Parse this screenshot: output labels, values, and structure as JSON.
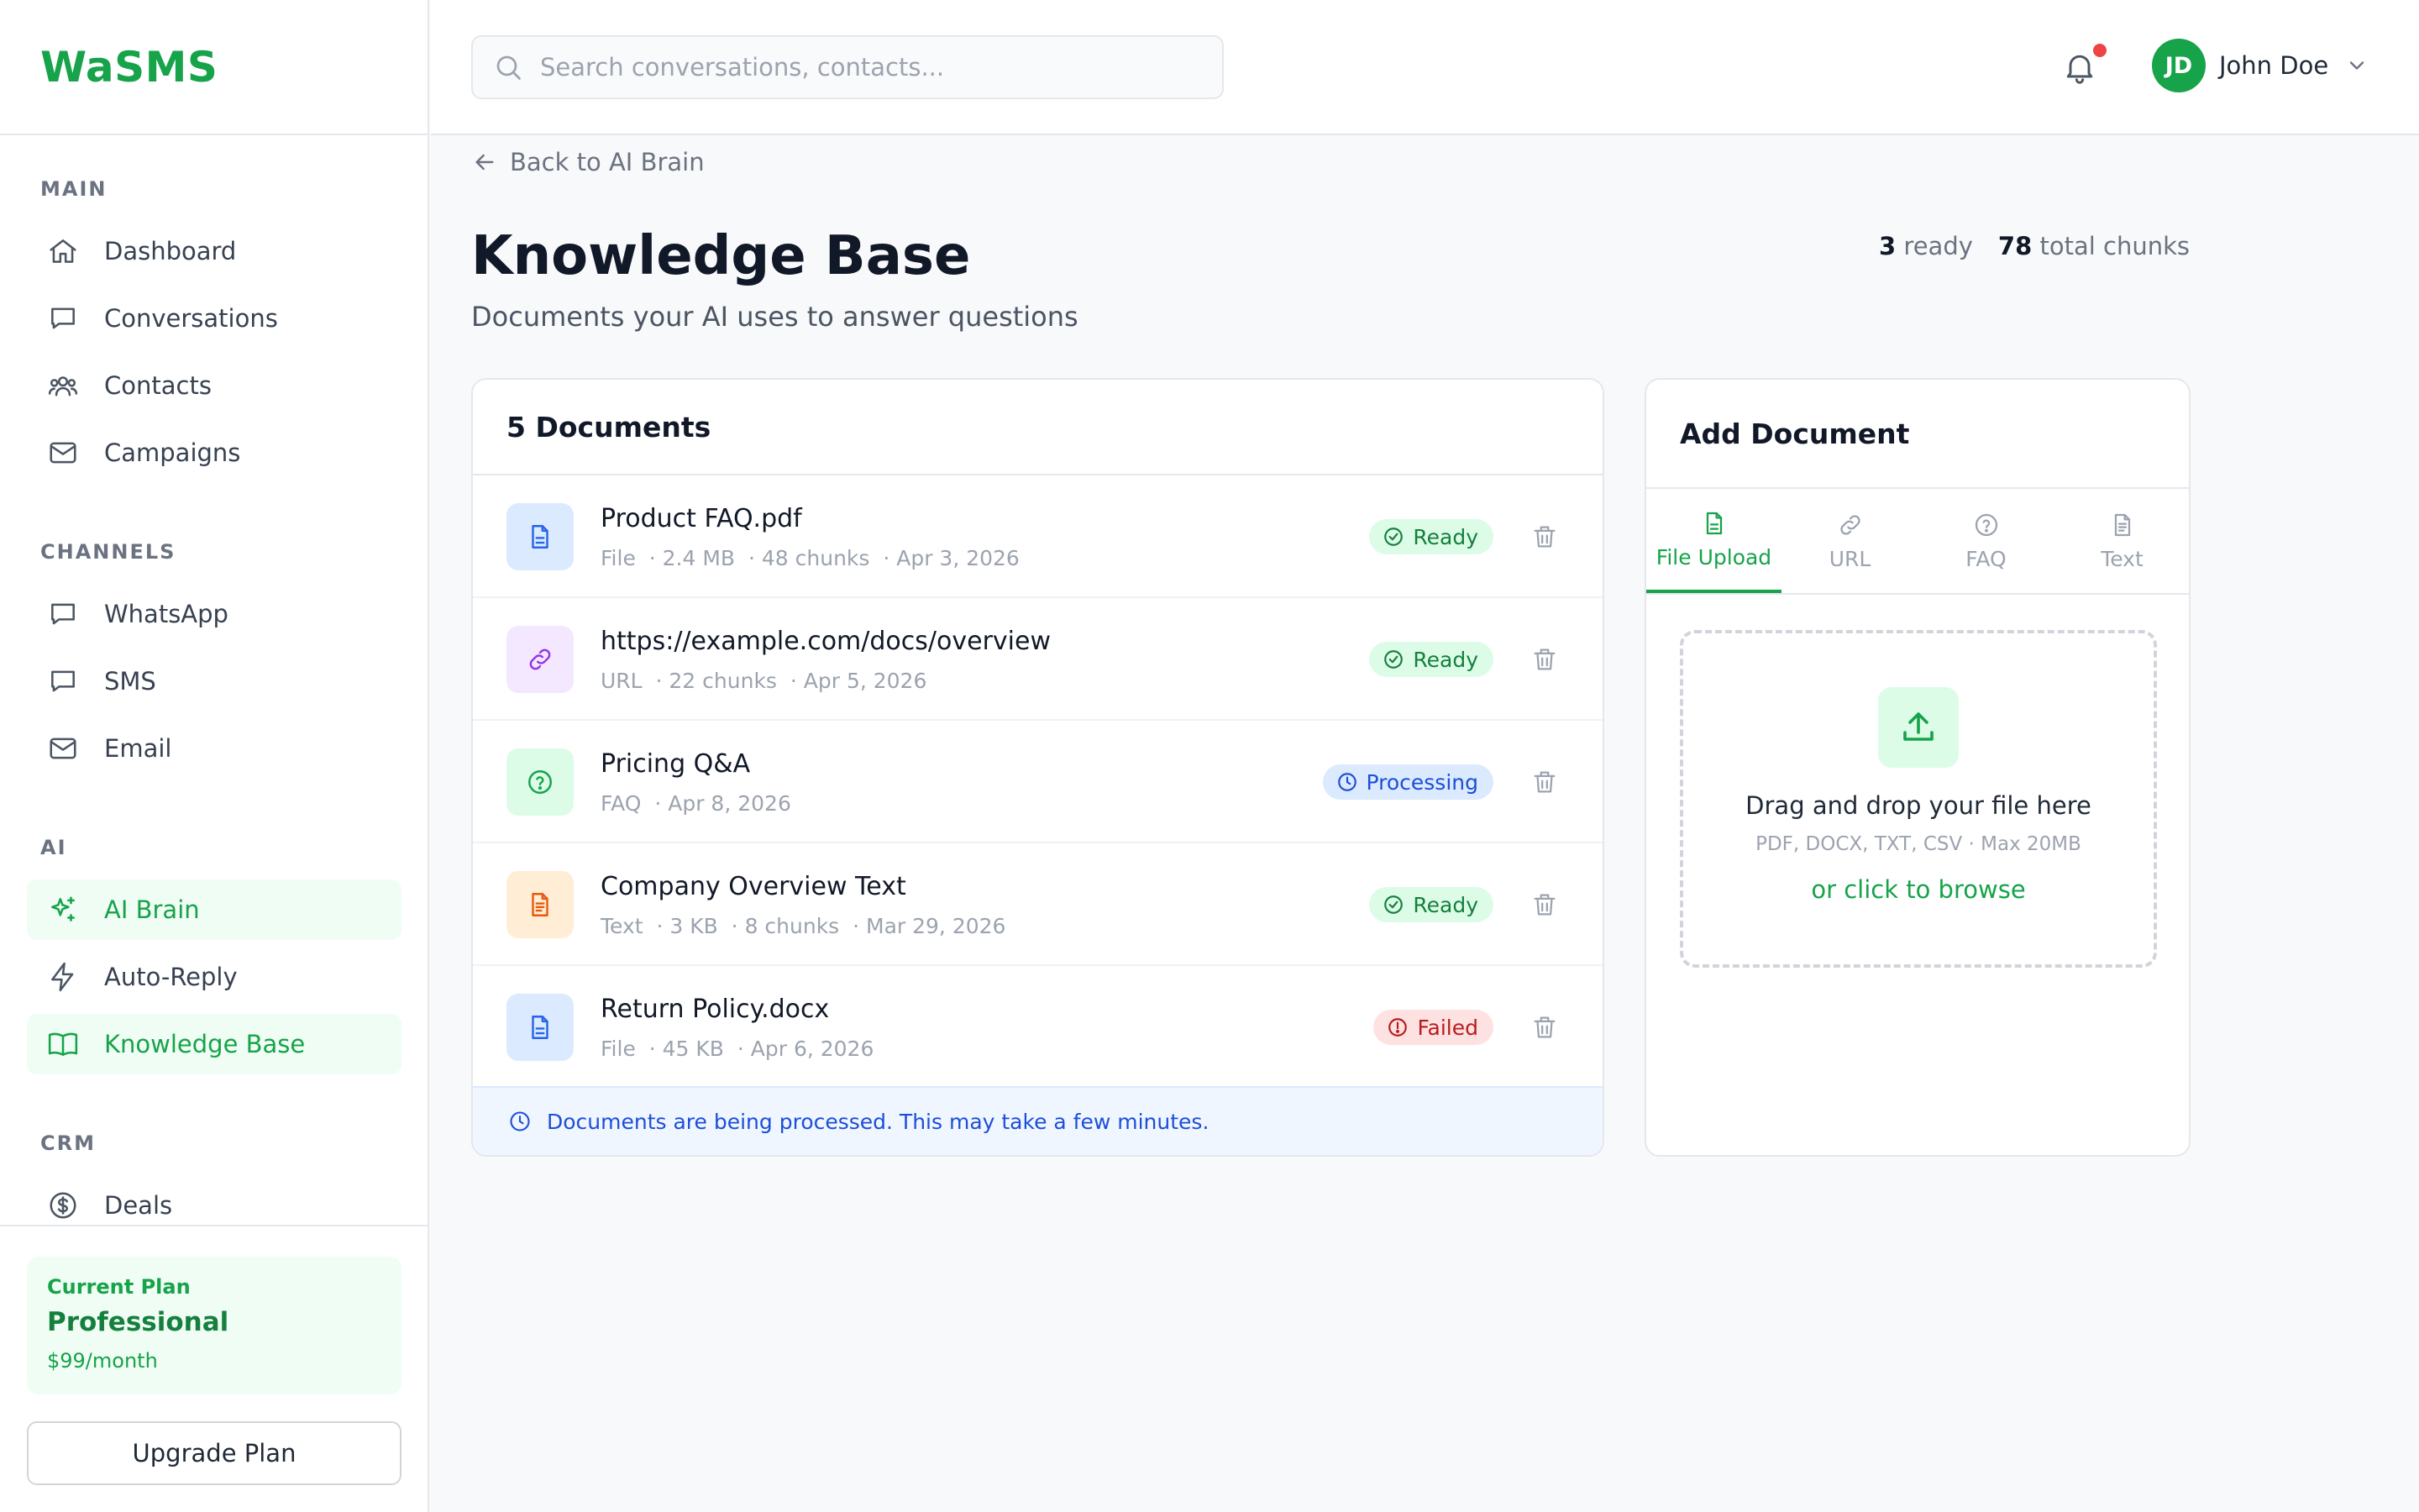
{
  "app": {
    "name": "WaSMS"
  },
  "colors": {
    "brand": "#16a34a",
    "ready": "#15803d",
    "processing": "#1d4ed8",
    "failed": "#b91c1c"
  },
  "sidebar": {
    "sections": [
      {
        "title": "MAIN",
        "items": [
          {
            "label": "Dashboard",
            "icon": "home-icon"
          },
          {
            "label": "Conversations",
            "icon": "chat-icon"
          },
          {
            "label": "Contacts",
            "icon": "users-icon"
          },
          {
            "label": "Campaigns",
            "icon": "mail-icon"
          }
        ]
      },
      {
        "title": "CHANNELS",
        "items": [
          {
            "label": "WhatsApp",
            "icon": "chat-icon"
          },
          {
            "label": "SMS",
            "icon": "chat-icon"
          },
          {
            "label": "Email",
            "icon": "mail-icon"
          }
        ]
      },
      {
        "title": "AI",
        "items": [
          {
            "label": "AI Brain",
            "icon": "sparkles-icon",
            "active": true
          },
          {
            "label": "Auto-Reply",
            "icon": "bolt-icon"
          },
          {
            "label": "Knowledge Base",
            "icon": "book-icon",
            "active": true
          }
        ]
      },
      {
        "title": "CRM",
        "items": [
          {
            "label": "Deals",
            "icon": "dollar-icon"
          }
        ]
      }
    ],
    "plan": {
      "label": "Current Plan",
      "name": "Professional",
      "price": "$99/month"
    },
    "upgrade_label": "Upgrade Plan"
  },
  "header": {
    "search_placeholder": "Search conversations, contacts...",
    "user": {
      "initials": "JD",
      "name": "John Doe"
    },
    "has_notification": true
  },
  "page": {
    "back_label": "Back to AI Brain",
    "title": "Knowledge Base",
    "subtitle": "Documents your AI uses to answer questions",
    "stats": {
      "ready_count": "3",
      "ready_label": "ready",
      "chunks_count": "78",
      "chunks_label": "total chunks"
    }
  },
  "documents": {
    "heading": "5 Documents",
    "items": [
      {
        "name": "Product FAQ.pdf",
        "meta": [
          "File",
          "2.4 MB",
          "48 chunks",
          "Apr 3, 2026"
        ],
        "status": "Ready",
        "status_type": "ready",
        "icon": "file-icon",
        "icon_bg": "#dbeafe",
        "icon_color": "#2563eb"
      },
      {
        "name": "https://example.com/docs/overview",
        "meta": [
          "URL",
          "22 chunks",
          "Apr 5, 2026"
        ],
        "status": "Ready",
        "status_type": "ready",
        "icon": "link-icon",
        "icon_bg": "#f3e8ff",
        "icon_color": "#9333ea"
      },
      {
        "name": "Pricing Q&A",
        "meta": [
          "FAQ",
          "Apr 8, 2026"
        ],
        "status": "Processing",
        "status_type": "processing",
        "icon": "question-icon",
        "icon_bg": "#dcfce7",
        "icon_color": "#16a34a"
      },
      {
        "name": "Company Overview Text",
        "meta": [
          "Text",
          "3 KB",
          "8 chunks",
          "Mar 29, 2026"
        ],
        "status": "Ready",
        "status_type": "ready",
        "icon": "text-file-icon",
        "icon_bg": "#ffedd5",
        "icon_color": "#ea580c"
      },
      {
        "name": "Return Policy.docx",
        "meta": [
          "File",
          "45 KB",
          "Apr 6, 2026"
        ],
        "status": "Failed",
        "status_type": "failed",
        "icon": "file-icon",
        "icon_bg": "#dbeafe",
        "icon_color": "#2563eb"
      }
    ],
    "notice": "Documents are being processed. This may take a few minutes."
  },
  "add_document": {
    "heading": "Add Document",
    "tabs": [
      {
        "label": "File Upload",
        "icon": "file-icon",
        "active": true
      },
      {
        "label": "URL",
        "icon": "link-icon"
      },
      {
        "label": "FAQ",
        "icon": "question-icon"
      },
      {
        "label": "Text",
        "icon": "text-file-icon"
      }
    ],
    "dropzone": {
      "title": "Drag and drop your file here",
      "types": "PDF, DOCX, TXT, CSV · Max 20MB",
      "browse": "or click to browse"
    }
  }
}
